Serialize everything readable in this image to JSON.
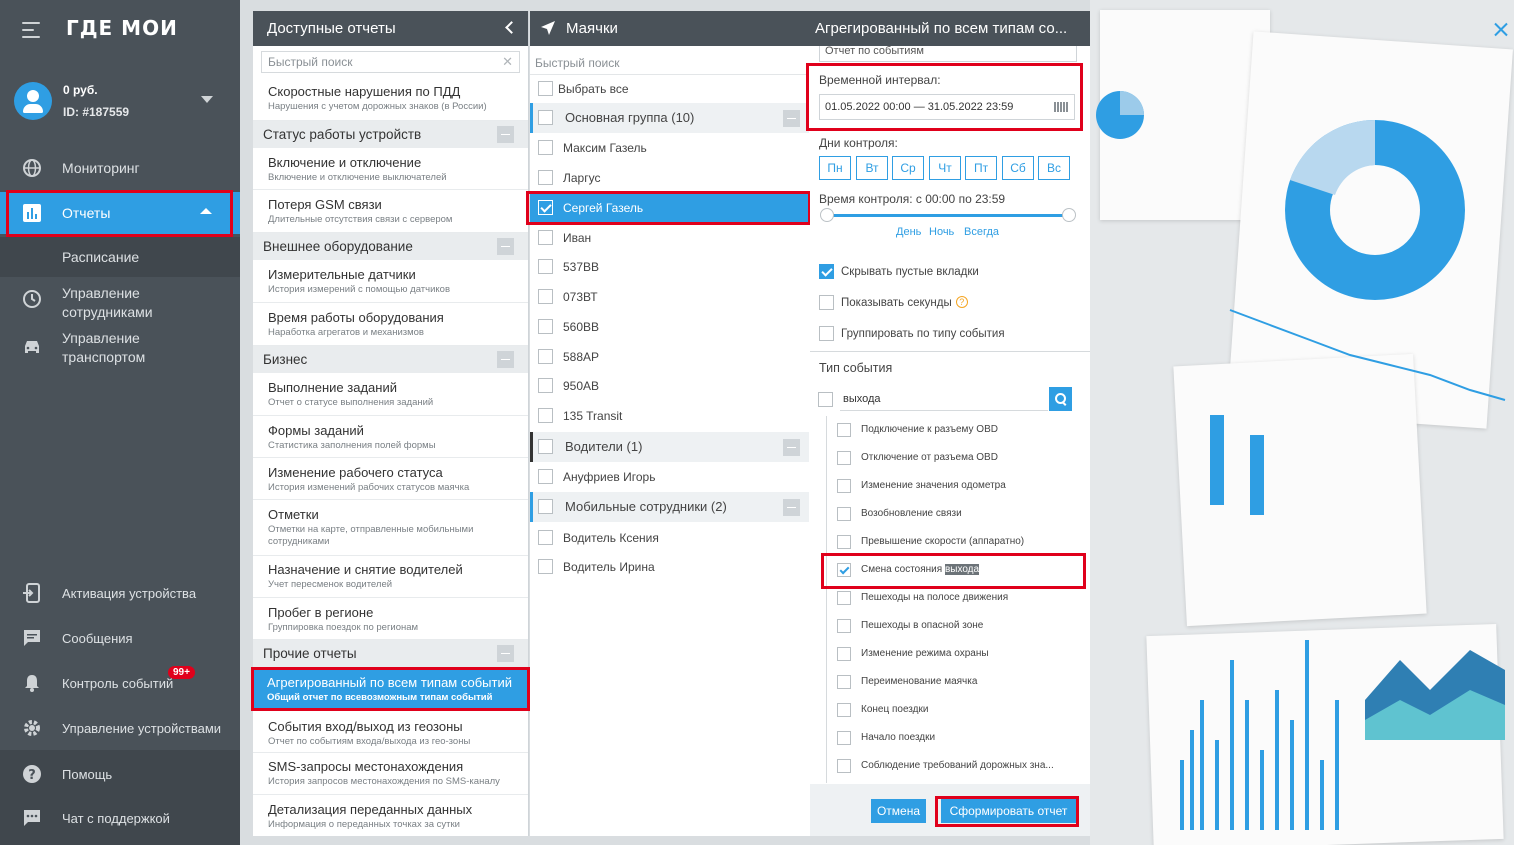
{
  "sidebar": {
    "logo_text": "ГДЕ МОИ",
    "account": {
      "balance": "0 руб.",
      "id": "ID: #187559"
    },
    "nav": [
      {
        "label": "Мониторинг"
      },
      {
        "label": "Отчеты"
      },
      {
        "label": "Расписание"
      },
      {
        "label": "Управление сотрудниками"
      },
      {
        "label": "Управление транспортом"
      },
      {
        "label": "Активация устройства"
      },
      {
        "label": "Сообщения"
      },
      {
        "label": "Контроль событий"
      },
      {
        "label": "Управление устройствами"
      },
      {
        "label": "Помощь"
      },
      {
        "label": "Чат с поддержкой"
      }
    ],
    "events_badge": "99+"
  },
  "reports": {
    "title": "Доступные отчеты",
    "search_placeholder": "Быстрый поиск",
    "items": [
      {
        "title": "Скоростные нарушения по ПДД",
        "desc": "Нарушения с учетом дорожных знаков (в России)"
      },
      {
        "title": "Включение и отключение",
        "desc": "Включение и отключение выключателей"
      },
      {
        "title": "Потеря GSM связи",
        "desc": "Длительные отсутствия связи с сервером"
      },
      {
        "title": "Измерительные датчики",
        "desc": "История измерений с помощью датчиков"
      },
      {
        "title": "Время работы оборудования",
        "desc": "Наработка агрегатов и механизмов"
      },
      {
        "title": "Выполнение заданий",
        "desc": "Отчет о статусе выполнения заданий"
      },
      {
        "title": "Формы заданий",
        "desc": "Статистика заполнения полей формы"
      },
      {
        "title": "Изменение рабочего статуса",
        "desc": "История изменений рабочих статусов маячка"
      },
      {
        "title": "Отметки",
        "desc": "Отметки на карте, отправленные мобильными сотрудниками"
      },
      {
        "title": "Назначение и снятие водителей",
        "desc": "Учет пересменок водителей"
      },
      {
        "title": "Пробег в регионе",
        "desc": "Группировка поездок по регионам"
      },
      {
        "title": "Агрегированный по всем типам событий",
        "desc": "Общий отчет по всевозможным типам событий"
      },
      {
        "title": "События вход/выход из геозоны",
        "desc": "Отчет по событиям входа/выхода из гео-зоны"
      },
      {
        "title": "SMS-запросы местонахождения",
        "desc": "История запросов местонахождения по SMS-каналу"
      },
      {
        "title": "Детализация переданных данных",
        "desc": "Информация о переданных точках за сутки"
      }
    ],
    "categories": [
      "Статус работы устройств",
      "Внешнее оборудование",
      "Бизнес",
      "Прочие отчеты"
    ]
  },
  "beacons": {
    "title": "Маячки",
    "search_placeholder": "Быстрый поиск",
    "select_all": "Выбрать все",
    "groups": [
      "Основная группа (10)",
      "Водители (1)",
      "Мобильные сотрудники (2)"
    ],
    "items": [
      "Максим Газель",
      "Ларгус",
      "Сергей Газель",
      "Иван",
      "537ВВ",
      "073ВТ",
      "560ВВ",
      "588АР",
      "950АВ",
      "135 Transit",
      "Ануфриев Игорь",
      "Водитель Ксения",
      "Водитель Ирина"
    ]
  },
  "settings": {
    "title": "Агрегированный по всем типам со...",
    "report_type_value": "Отчет по событиям",
    "interval_label": "Временной интервал:",
    "interval_value": "01.05.2022 00:00 — 31.05.2022 23:59",
    "days_label": "Дни контроля:",
    "days": [
      "Пн",
      "Вт",
      "Ср",
      "Чт",
      "Пт",
      "Сб",
      "Вс"
    ],
    "time_label": "Время контроля: с 00:00 по 23:59",
    "time_links": [
      "День",
      "Ночь",
      "Всегда"
    ],
    "options": [
      {
        "label": "Скрывать пустые вкладки",
        "checked": true
      },
      {
        "label": "Показывать секунды",
        "checked": false
      },
      {
        "label": "Группировать по типу события",
        "checked": false
      }
    ],
    "event_type_label": "Тип события",
    "event_search_value": "выхода",
    "events": [
      "Подключение к разъему OBD",
      "Отключение от разъема OBD",
      "Изменение значения одометра",
      "Возобновление связи",
      "Превышение скорости (аппаратно)",
      "Смена состояния",
      "Пешеходы на полосе движения",
      "Пешеходы в опасной зоне",
      "Изменение режима охраны",
      "Переименование маячка",
      "Конец поездки",
      "Начало поездки",
      "Соблюдение требований дорожных зна..."
    ],
    "event_highlight": "выхода",
    "cancel_label": "Отмена",
    "submit_label": "Сформировать отчет"
  },
  "colors": {
    "accent": "#2f9ee3",
    "sidebar_bg": "#4a5259",
    "highlight_border": "#e0001b"
  }
}
